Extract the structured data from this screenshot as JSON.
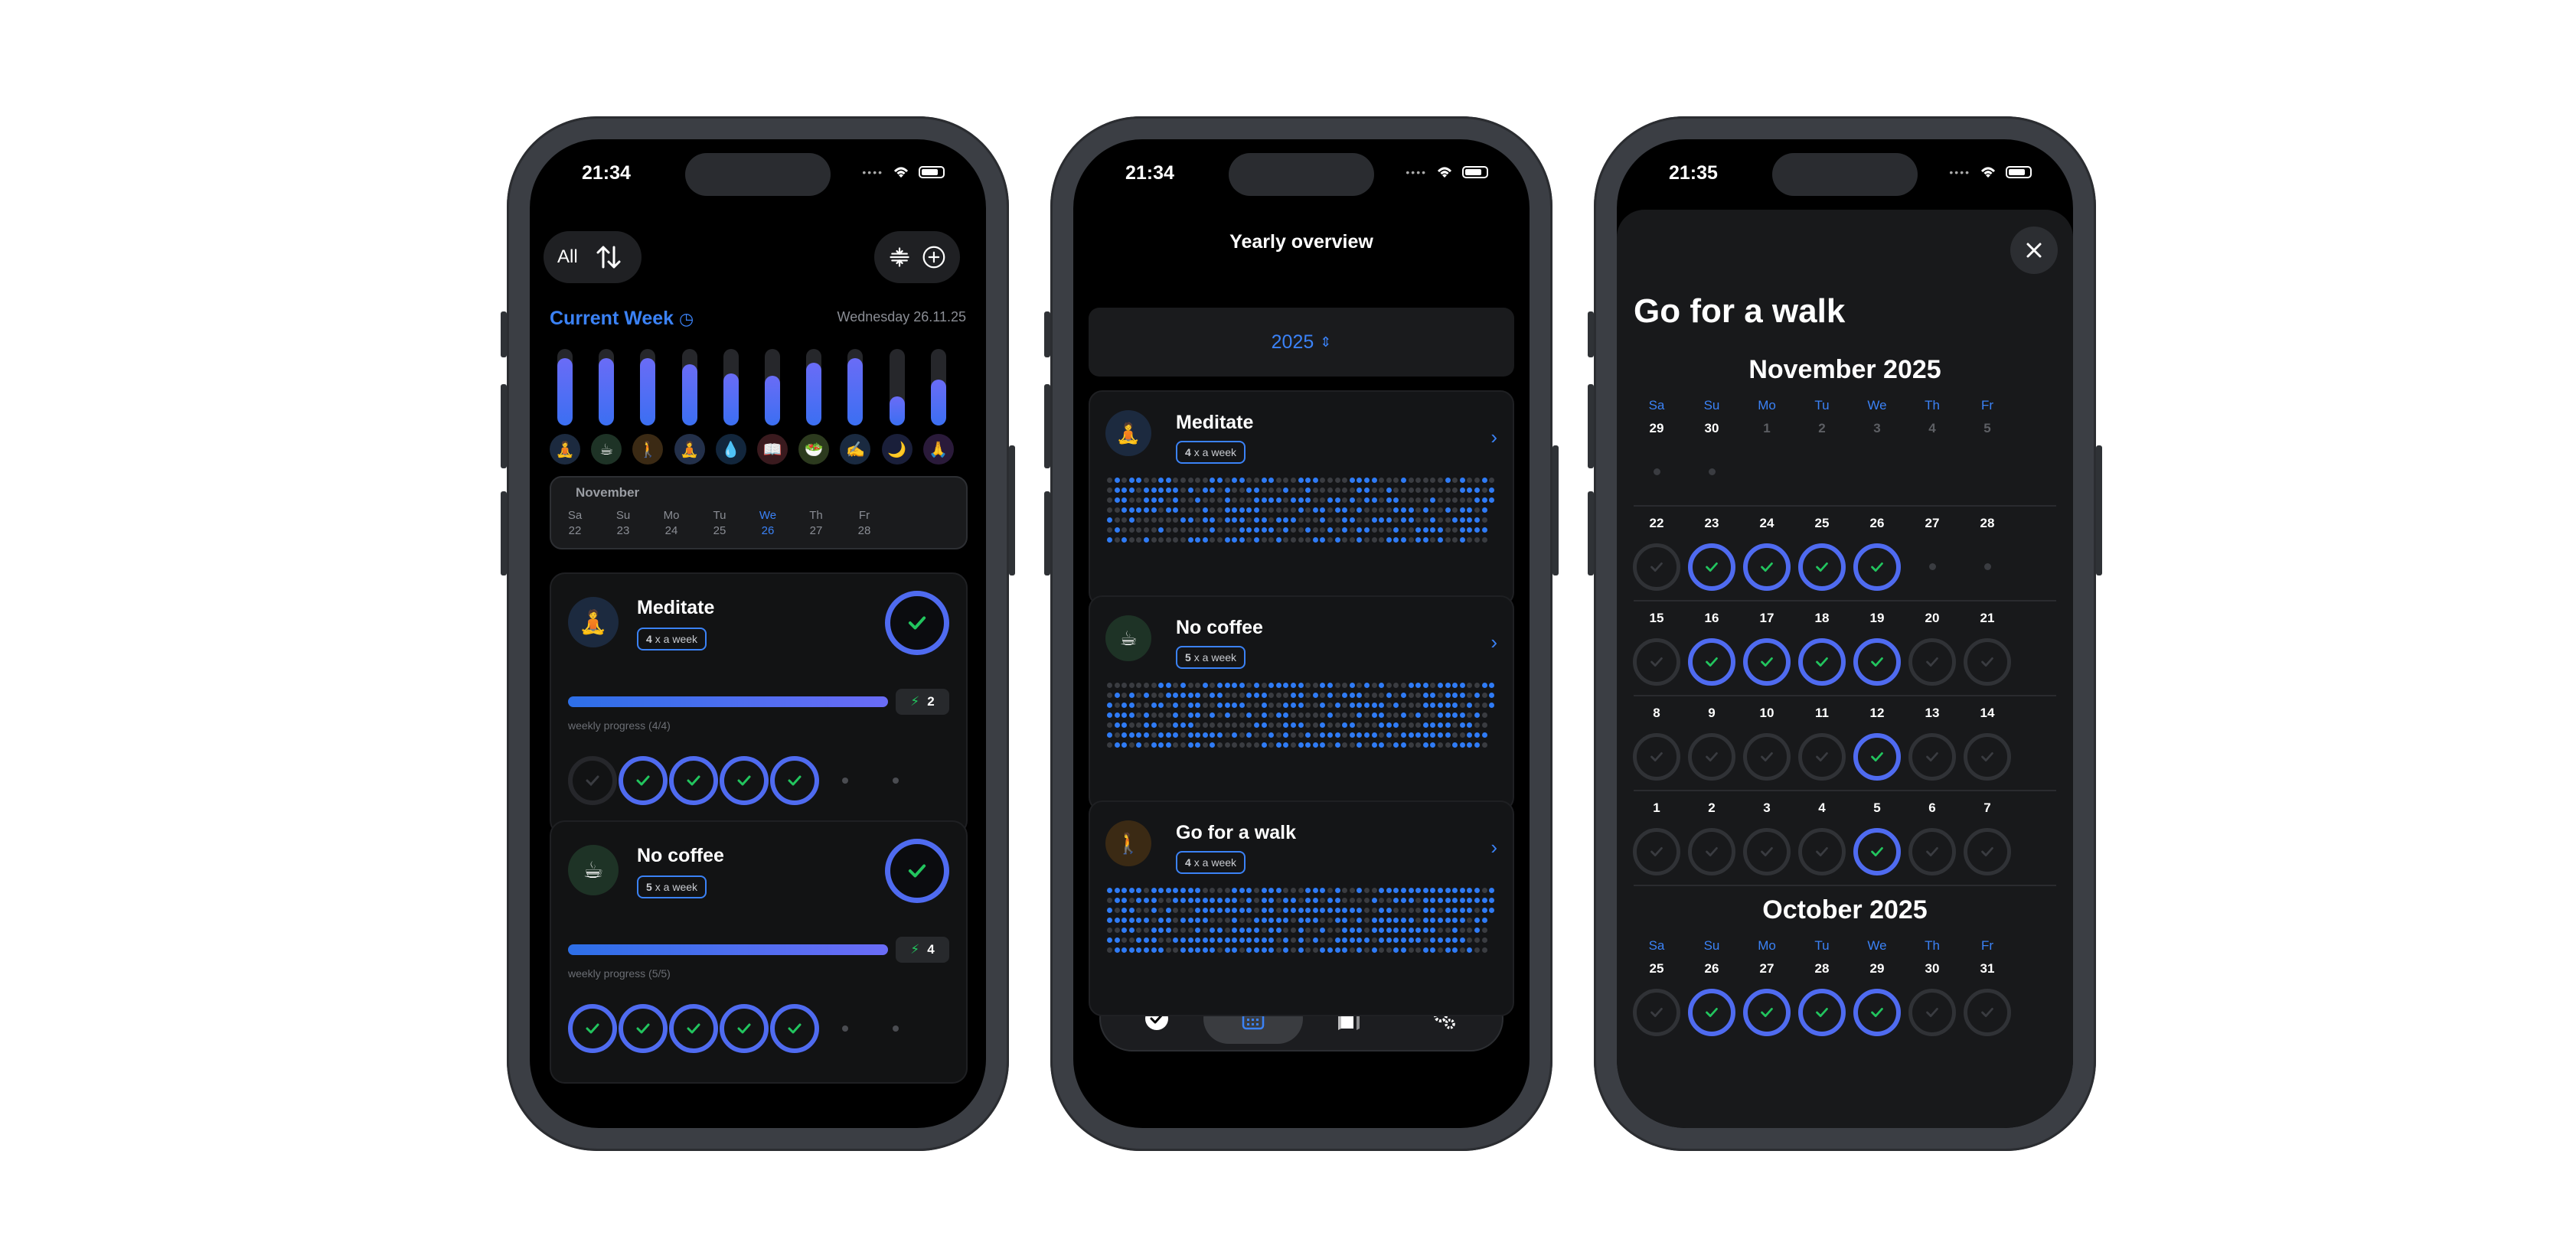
{
  "colors": {
    "accent": "#3b82f6",
    "ring": "#4f6bf0",
    "check": "#22c55e",
    "background": "#000000"
  },
  "phone1": {
    "status": {
      "time": "21:34"
    },
    "toolbar": {
      "filter_label": "All"
    },
    "week": {
      "title": "Current Week",
      "date": "Wednesday 26.11.25",
      "bars": [
        0.88,
        0.88,
        0.88,
        0.8,
        0.68,
        0.65,
        0.82,
        0.88,
        0.38,
        0.6
      ],
      "habit_icons": [
        "🧘",
        "☕",
        "🚶",
        "🧘",
        "💧",
        "📖",
        "🥗",
        "✍️",
        "🌙",
        "🙏"
      ]
    },
    "calendar": {
      "month": "November",
      "days": [
        {
          "wd": "Sa",
          "d": "22"
        },
        {
          "wd": "Su",
          "d": "23"
        },
        {
          "wd": "Mo",
          "d": "24"
        },
        {
          "wd": "Tu",
          "d": "25"
        },
        {
          "wd": "We",
          "d": "26"
        },
        {
          "wd": "Th",
          "d": "27"
        },
        {
          "wd": "Fr",
          "d": "28"
        }
      ]
    },
    "habits": [
      {
        "name": "Meditate",
        "icon": "🧘",
        "freq_num": "4",
        "freq_text": "x a week",
        "streak": "2",
        "progress_label": "weekly progress   (4/4)",
        "progress": 1.0,
        "days": [
          0,
          1,
          1,
          1,
          1,
          -1,
          -1
        ]
      },
      {
        "name": "No coffee",
        "icon": "☕",
        "freq_num": "5",
        "freq_text": "x a week",
        "streak": "4",
        "progress_label": "weekly progress   (5/5)",
        "progress": 1.0,
        "days": [
          1,
          1,
          1,
          1,
          1,
          -1,
          -1
        ]
      }
    ]
  },
  "phone2": {
    "status": {
      "time": "21:34"
    },
    "title": "Yearly overview",
    "year": "2025",
    "habits": [
      {
        "name": "Meditate",
        "icon": "🧘",
        "freq_num": "4",
        "freq_text": "x a week"
      },
      {
        "name": "No coffee",
        "icon": "☕",
        "freq_num": "5",
        "freq_text": "x a week"
      },
      {
        "name": "Go for a walk",
        "icon": "🚶",
        "freq_num": "4",
        "freq_text": "x a week"
      }
    ]
  },
  "phone3": {
    "status": {
      "time": "21:35"
    },
    "habit_title": "Go for a walk",
    "weekdays": [
      "Sa",
      "Su",
      "Mo",
      "Tu",
      "We",
      "Th",
      "Fr"
    ],
    "months": [
      {
        "title": "November 2025",
        "weeks": [
          {
            "days": [
              "29",
              "30",
              "1",
              "2",
              "3",
              "4",
              "5"
            ],
            "state": [
              "dot",
              "dot",
              "dim",
              "dim",
              "dim",
              "dim",
              "dim"
            ]
          },
          {
            "days": [
              "22",
              "23",
              "24",
              "25",
              "26",
              "27",
              "28"
            ],
            "state": [
              "off",
              "on",
              "on",
              "on",
              "on",
              "dot",
              "dot"
            ]
          },
          {
            "days": [
              "15",
              "16",
              "17",
              "18",
              "19",
              "20",
              "21"
            ],
            "state": [
              "off",
              "on",
              "on",
              "on",
              "on",
              "off",
              "off"
            ]
          },
          {
            "days": [
              "8",
              "9",
              "10",
              "11",
              "12",
              "13",
              "14"
            ],
            "state": [
              "off",
              "off",
              "off",
              "off",
              "on",
              "off",
              "off"
            ]
          },
          {
            "days": [
              "1",
              "2",
              "3",
              "4",
              "5",
              "6",
              "7"
            ],
            "state": [
              "off",
              "off",
              "off",
              "off",
              "on",
              "off",
              "off"
            ]
          }
        ]
      },
      {
        "title": "October 2025",
        "weeks": [
          {
            "days": [
              "25",
              "26",
              "27",
              "28",
              "29",
              "30",
              "31"
            ],
            "state": [
              "off",
              "on",
              "on",
              "on",
              "on",
              "off",
              "off"
            ]
          }
        ]
      }
    ]
  }
}
